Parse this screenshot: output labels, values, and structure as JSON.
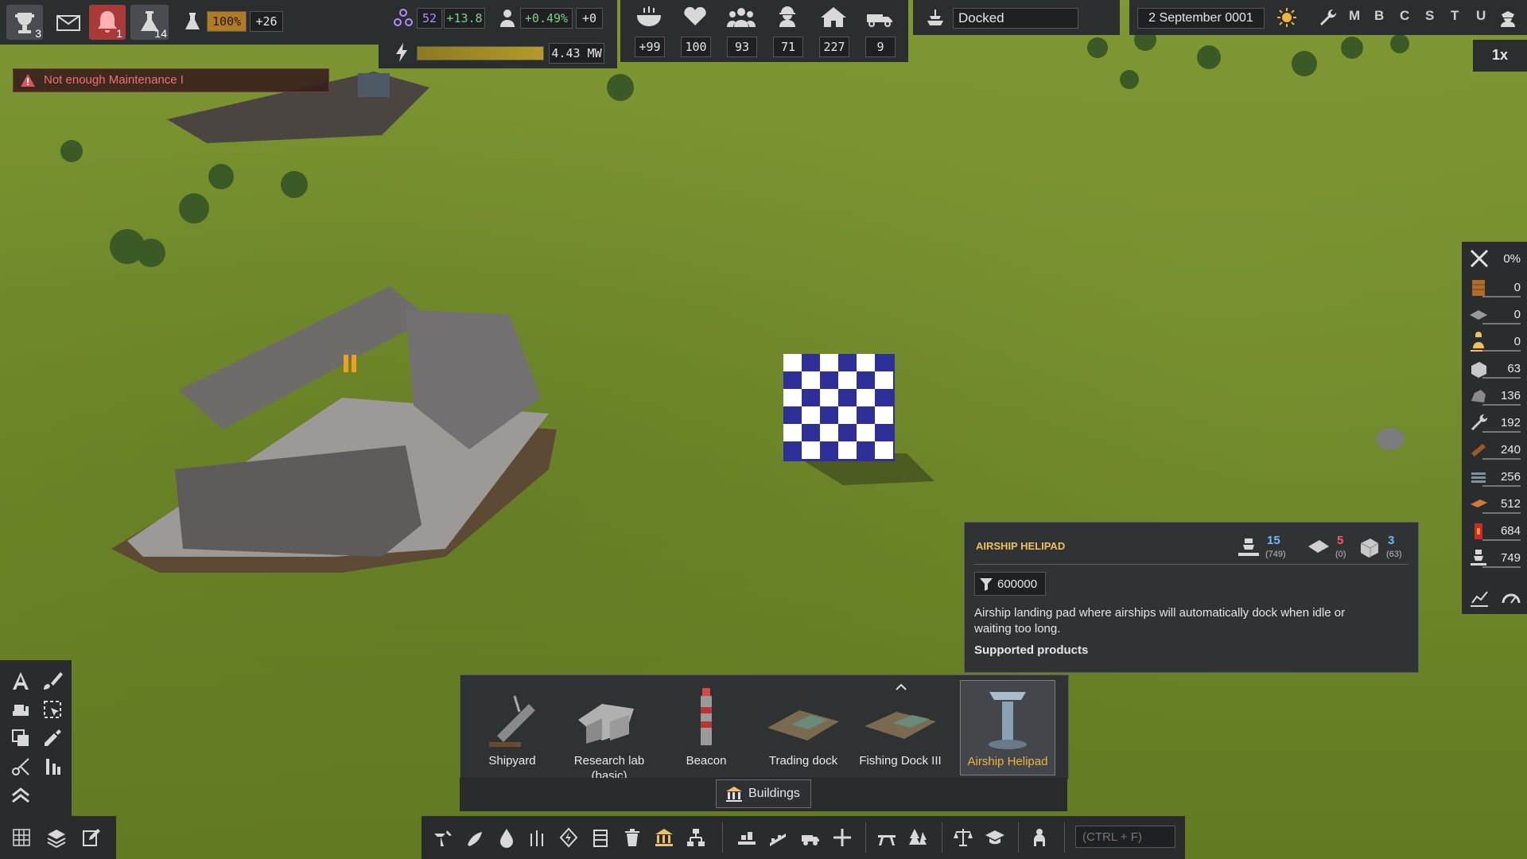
{
  "top_bar": {
    "trophy_count": "3",
    "notification_count": "1",
    "research_count": "14",
    "research_pct": "100%",
    "research_delta": "+26",
    "unity_value": "52",
    "unity_delta": "+13.8",
    "pop_growth": "+0.49%",
    "pop_delta": "+0",
    "power_value": "4.43 MW",
    "stats": {
      "food": "+99",
      "health": "100",
      "population": "93",
      "workers": "71",
      "housing": "227",
      "vehicles": "9"
    },
    "ship_status": "Docked",
    "date": "2 September 0001",
    "shortcuts": [
      "M",
      "B",
      "C",
      "S",
      "T",
      "U"
    ],
    "speed": "1x"
  },
  "alert": {
    "text": "Not enough Maintenance I",
    "color": "#e05555"
  },
  "resources": {
    "maintenance_pct": "0%",
    "items": [
      {
        "icon": "crate-icon",
        "value": "0"
      },
      {
        "icon": "plate-icon",
        "value": "0"
      },
      {
        "icon": "worker-icon",
        "value": "0"
      },
      {
        "icon": "concrete-icon",
        "value": "63"
      },
      {
        "icon": "rock-icon",
        "value": "136"
      },
      {
        "icon": "wrench-icon",
        "value": "192"
      },
      {
        "icon": "wood-icon",
        "value": "240"
      },
      {
        "icon": "steel-icon",
        "value": "256"
      },
      {
        "icon": "copper-icon",
        "value": "512"
      },
      {
        "icon": "fuel-icon",
        "value": "684"
      },
      {
        "icon": "crew-icon",
        "value": "749"
      }
    ]
  },
  "tooltip": {
    "title": "AIRSHIP HELIPAD",
    "costs": [
      {
        "icon": "crew-icon",
        "value": "15",
        "sub": "(749)",
        "color": "#6fb7ff"
      },
      {
        "icon": "plate-icon",
        "value": "5",
        "sub": "(0)",
        "color": "#ff5a5a"
      },
      {
        "icon": "concrete-icon",
        "value": "3",
        "sub": "(63)",
        "color": "#6fb7ff"
      }
    ],
    "funnel_value": "600000",
    "description": "Airship landing pad where airships will automatically dock when idle or waiting too long.",
    "supported_label": "Supported products"
  },
  "build_menu": {
    "items": [
      {
        "label": "Shipyard",
        "selected": false
      },
      {
        "label": "Research lab (basic)",
        "selected": false
      },
      {
        "label": "Beacon",
        "selected": false
      },
      {
        "label": "Trading dock",
        "selected": false
      },
      {
        "label": "Fishing Dock III",
        "selected": false
      },
      {
        "label": "Airship Helipad",
        "selected": true
      }
    ],
    "category_label": "Buildings",
    "accent": "#f0b443"
  },
  "search": {
    "placeholder": "(CTRL + F)"
  }
}
